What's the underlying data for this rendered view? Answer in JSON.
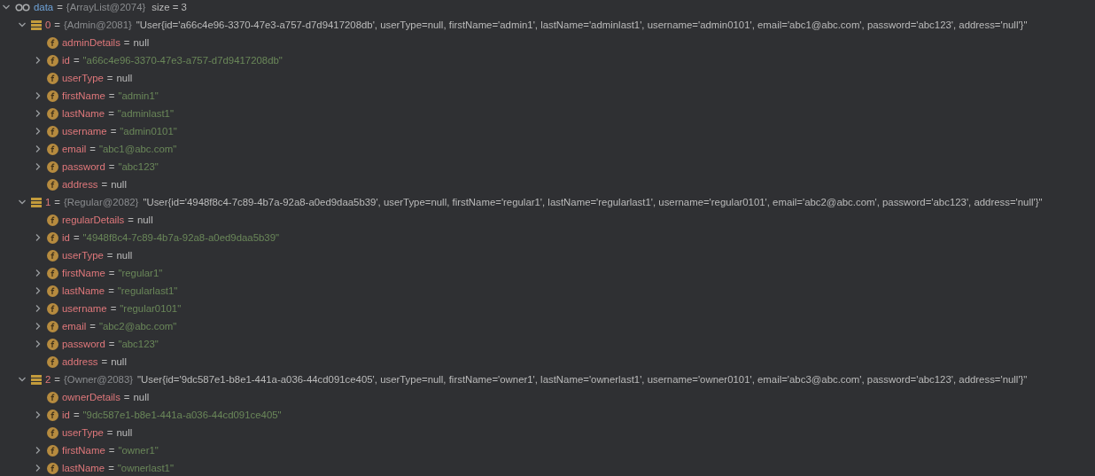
{
  "variables": [
    {
      "kind": "watch",
      "name": "data",
      "sep": "=",
      "type": "{ArrayList@2074}",
      "extra": "size = 3",
      "expanded": true,
      "children": [
        {
          "kind": "element",
          "name": "0",
          "sep": "=",
          "type": "{Admin@2081}",
          "value": "\"User{id='a66c4e96-3370-47e3-a757-d7d9417208db', userType=null, firstName='admin1', lastName='adminlast1', username='admin0101', email='abc1@abc.com', password='abc123', address='null'}\"",
          "expanded": true,
          "children": [
            {
              "kind": "nullfield",
              "name": "adminDetails",
              "sep": "=",
              "value": "null"
            },
            {
              "kind": "stringfield",
              "name": "id",
              "sep": "=",
              "value": "\"a66c4e96-3370-47e3-a757-d7d9417208db\"",
              "expanded": false
            },
            {
              "kind": "nullfield",
              "name": "userType",
              "sep": "=",
              "value": "null"
            },
            {
              "kind": "stringfield",
              "name": "firstName",
              "sep": "=",
              "value": "\"admin1\"",
              "expanded": false
            },
            {
              "kind": "stringfield",
              "name": "lastName",
              "sep": "=",
              "value": "\"adminlast1\"",
              "expanded": false
            },
            {
              "kind": "stringfield",
              "name": "username",
              "sep": "=",
              "value": "\"admin0101\"",
              "expanded": false
            },
            {
              "kind": "stringfield",
              "name": "email",
              "sep": "=",
              "value": "\"abc1@abc.com\"",
              "expanded": false
            },
            {
              "kind": "stringfield",
              "name": "password",
              "sep": "=",
              "value": "\"abc123\"",
              "expanded": false
            },
            {
              "kind": "nullfield",
              "name": "address",
              "sep": "=",
              "value": "null"
            }
          ]
        },
        {
          "kind": "element",
          "name": "1",
          "sep": "=",
          "type": "{Regular@2082}",
          "value": "\"User{id='4948f8c4-7c89-4b7a-92a8-a0ed9daa5b39', userType=null, firstName='regular1', lastName='regularlast1', username='regular0101', email='abc2@abc.com', password='abc123', address='null'}\"",
          "expanded": true,
          "children": [
            {
              "kind": "nullfield",
              "name": "regularDetails",
              "sep": "=",
              "value": "null"
            },
            {
              "kind": "stringfield",
              "name": "id",
              "sep": "=",
              "value": "\"4948f8c4-7c89-4b7a-92a8-a0ed9daa5b39\"",
              "expanded": false
            },
            {
              "kind": "nullfield",
              "name": "userType",
              "sep": "=",
              "value": "null"
            },
            {
              "kind": "stringfield",
              "name": "firstName",
              "sep": "=",
              "value": "\"regular1\"",
              "expanded": false
            },
            {
              "kind": "stringfield",
              "name": "lastName",
              "sep": "=",
              "value": "\"regularlast1\"",
              "expanded": false
            },
            {
              "kind": "stringfield",
              "name": "username",
              "sep": "=",
              "value": "\"regular0101\"",
              "expanded": false
            },
            {
              "kind": "stringfield",
              "name": "email",
              "sep": "=",
              "value": "\"abc2@abc.com\"",
              "expanded": false
            },
            {
              "kind": "stringfield",
              "name": "password",
              "sep": "=",
              "value": "\"abc123\"",
              "expanded": false
            },
            {
              "kind": "nullfield",
              "name": "address",
              "sep": "=",
              "value": "null"
            }
          ]
        },
        {
          "kind": "element",
          "name": "2",
          "sep": "=",
          "type": "{Owner@2083}",
          "value": "\"User{id='9dc587e1-b8e1-441a-a036-44cd091ce405', userType=null, firstName='owner1', lastName='ownerlast1', username='owner0101', email='abc3@abc.com', password='abc123', address='null'}\"",
          "expanded": true,
          "children": [
            {
              "kind": "nullfield",
              "name": "ownerDetails",
              "sep": "=",
              "value": "null"
            },
            {
              "kind": "stringfield",
              "name": "id",
              "sep": "=",
              "value": "\"9dc587e1-b8e1-441a-a036-44cd091ce405\"",
              "expanded": false
            },
            {
              "kind": "nullfield",
              "name": "userType",
              "sep": "=",
              "value": "null"
            },
            {
              "kind": "stringfield",
              "name": "firstName",
              "sep": "=",
              "value": "\"owner1\"",
              "expanded": false
            },
            {
              "kind": "stringfield",
              "name": "lastName",
              "sep": "=",
              "value": "\"ownerlast1\"",
              "expanded": false
            }
          ]
        }
      ]
    }
  ]
}
